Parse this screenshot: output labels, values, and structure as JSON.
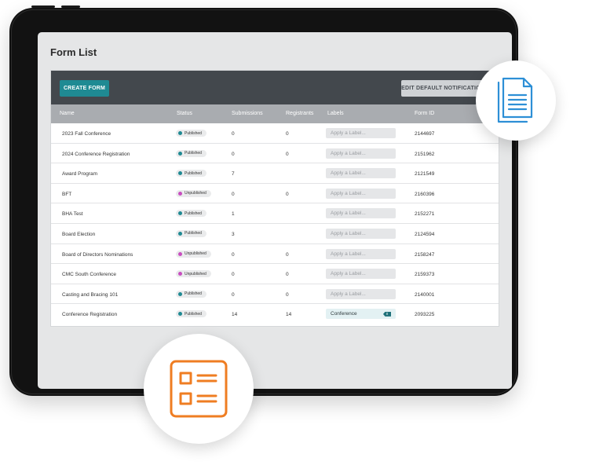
{
  "page": {
    "title": "Form List"
  },
  "toolbar": {
    "create_label": "CREATE FORM",
    "edit_notifications_label": "EDIT DEFAULT NOTIFICATIONS"
  },
  "table": {
    "columns": [
      "Name",
      "Status",
      "Submissions",
      "Registrants",
      "Labels",
      "Form ID"
    ],
    "label_placeholder": "Apply a Label...",
    "rows": [
      {
        "name": "2023 Fall Conference",
        "status": "Published",
        "submissions": "0",
        "registrants": "0",
        "label": "",
        "form_id": "2144697"
      },
      {
        "name": "2024 Conference Registration",
        "status": "Published",
        "submissions": "0",
        "registrants": "0",
        "label": "",
        "form_id": "2151962"
      },
      {
        "name": "Award Program",
        "status": "Published",
        "submissions": "7",
        "registrants": "",
        "label": "",
        "form_id": "2121549"
      },
      {
        "name": "BFT",
        "status": "Unpublished",
        "submissions": "0",
        "registrants": "0",
        "label": "",
        "form_id": "2160396"
      },
      {
        "name": "BHA Test",
        "status": "Published",
        "submissions": "1",
        "registrants": "",
        "label": "",
        "form_id": "2152271"
      },
      {
        "name": "Board Election",
        "status": "Published",
        "submissions": "3",
        "registrants": "",
        "label": "",
        "form_id": "2124594"
      },
      {
        "name": "Board of Directors Nominations",
        "status": "Unpublished",
        "submissions": "0",
        "registrants": "0",
        "label": "",
        "form_id": "2158247"
      },
      {
        "name": "CMC South Conference",
        "status": "Unpublished",
        "submissions": "0",
        "registrants": "0",
        "label": "",
        "form_id": "2159373"
      },
      {
        "name": "Casting and Bracing 101",
        "status": "Published",
        "submissions": "0",
        "registrants": "0",
        "label": "",
        "form_id": "2140001"
      },
      {
        "name": "Conference Registration",
        "status": "Published",
        "submissions": "14",
        "registrants": "14",
        "label": "Conference",
        "form_id": "2093225"
      }
    ]
  },
  "colors": {
    "published": "#1f8a93",
    "unpublished": "#c84fc0",
    "document_icon": "#2d8fd6",
    "list_icon": "#ef7d22"
  },
  "icons": {
    "top_right": "document-icon",
    "bottom": "checklist-icon"
  }
}
